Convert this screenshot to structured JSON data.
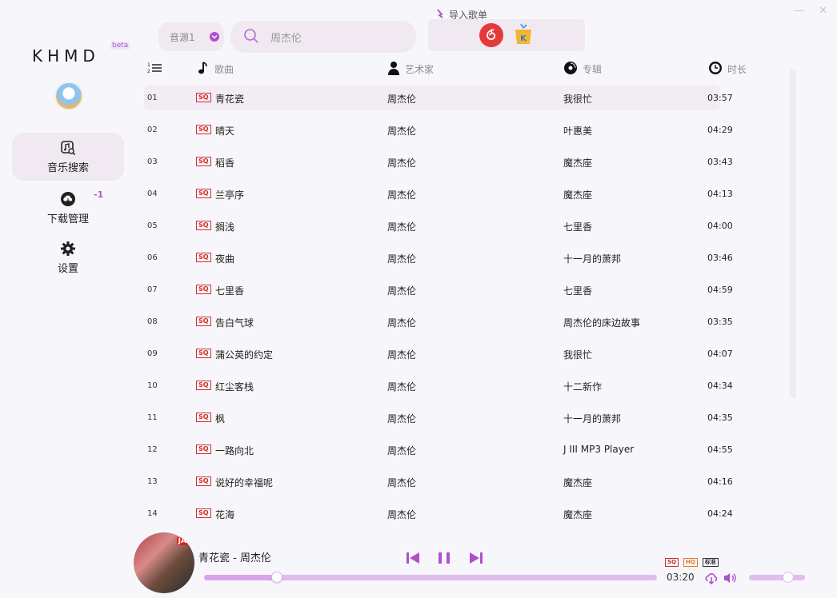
{
  "window": {
    "minimize_label": "—",
    "close_label": "✕"
  },
  "sidebar": {
    "logo": "KHMD",
    "beta": "beta",
    "items": [
      {
        "label": "音乐搜索",
        "icon": "music-search-icon",
        "active": true
      },
      {
        "label": "下载管理",
        "icon": "cloud-download-icon",
        "active": false
      },
      {
        "label": "设置",
        "icon": "gear-icon",
        "active": false
      }
    ],
    "download_badge": "-1"
  },
  "search": {
    "source_label": "音源1",
    "query": "周杰伦",
    "icon": "search-icon"
  },
  "import": {
    "title": "导入歌单",
    "sources": [
      "netease-music-icon",
      "kugou-music-icon"
    ]
  },
  "table": {
    "headers": {
      "index_icon": "ordered-list-icon",
      "title": "歌曲",
      "artist": "艺术家",
      "album": "专辑",
      "duration": "时长"
    },
    "quality_tag": "SQ",
    "rows": [
      {
        "num": "01",
        "title": "青花瓷",
        "artist": "周杰伦",
        "album": "我很忙",
        "duration": "03:57"
      },
      {
        "num": "02",
        "title": "晴天",
        "artist": "周杰伦",
        "album": "叶惠美",
        "duration": "04:29"
      },
      {
        "num": "03",
        "title": "稻香",
        "artist": "周杰伦",
        "album": "魔杰座",
        "duration": "03:43"
      },
      {
        "num": "04",
        "title": "兰亭序",
        "artist": "周杰伦",
        "album": "魔杰座",
        "duration": "04:13"
      },
      {
        "num": "05",
        "title": "搁浅",
        "artist": "周杰伦",
        "album": "七里香",
        "duration": "04:00"
      },
      {
        "num": "06",
        "title": "夜曲",
        "artist": "周杰伦",
        "album": "十一月的萧邦",
        "duration": "03:46"
      },
      {
        "num": "07",
        "title": "七里香",
        "artist": "周杰伦",
        "album": "七里香",
        "duration": "04:59"
      },
      {
        "num": "08",
        "title": "告白气球",
        "artist": "周杰伦",
        "album": "周杰伦的床边故事",
        "duration": "03:35"
      },
      {
        "num": "09",
        "title": "蒲公英的约定",
        "artist": "周杰伦",
        "album": "我很忙",
        "duration": "04:07"
      },
      {
        "num": "10",
        "title": "红尘客栈",
        "artist": "周杰伦",
        "album": "十二新作",
        "duration": "04:34"
      },
      {
        "num": "11",
        "title": "枫",
        "artist": "周杰伦",
        "album": "十一月的萧邦",
        "duration": "04:35"
      },
      {
        "num": "12",
        "title": "一路向北",
        "artist": "周杰伦",
        "album": "J III MP3 Player",
        "duration": "04:55"
      },
      {
        "num": "13",
        "title": "说好的幸福呢",
        "artist": "周杰伦",
        "album": "魔杰座",
        "duration": "04:16"
      },
      {
        "num": "14",
        "title": "花海",
        "artist": "周杰伦",
        "album": "魔杰座",
        "duration": "04:24"
      }
    ]
  },
  "player": {
    "now_playing": "青花瓷 - 周杰伦",
    "cover_tag": "JA",
    "elapsed": "03:20",
    "progress": 0.16,
    "volume": 0.7,
    "quality_tags": [
      "SQ",
      "HQ",
      "标准"
    ],
    "colors": {
      "accent": "#b14fcc",
      "sq": "#c9322d",
      "hq": "#e07a2a"
    }
  }
}
